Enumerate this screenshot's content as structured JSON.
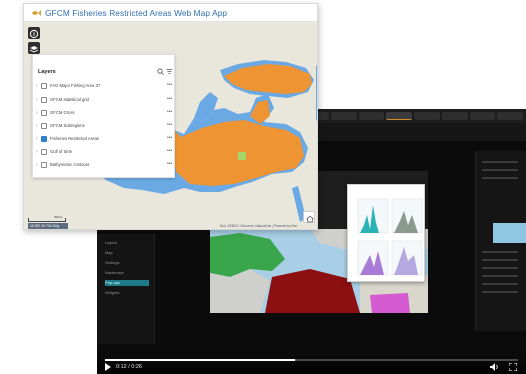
{
  "video": {
    "time": "0:12 / 0:26",
    "progress": 0.46,
    "left_panel_items": [
      "Layers",
      "Map",
      "Settings",
      "Basemaps",
      "Pop-ups",
      "Widgets"
    ],
    "selected_left_item": 4
  },
  "webmap": {
    "title": "GFCM Fisheries Restricted Areas Web Map App",
    "legend": {
      "title": "Layers",
      "layers": [
        {
          "label": "FAO Major Fishing Area 37",
          "checked": false
        },
        {
          "label": "GFCM statistical grid",
          "checked": false
        },
        {
          "label": "GFCM GSAs",
          "checked": false
        },
        {
          "label": "GFCM Subregions",
          "checked": false
        },
        {
          "label": "Fisheries Restricted Areas",
          "checked": true
        },
        {
          "label": "Gulf of Sirte",
          "checked": false
        },
        {
          "label": "Bathymetric contours",
          "checked": false
        }
      ]
    },
    "scale_label": "300mi",
    "coordinates": "15.987 40.734 Deg",
    "attribution": "Esri, GEBCO, DeLorme, NaturalVue | Powered by Esri",
    "colors": {
      "sea": "#6aa9e4",
      "land": "#e9e6dc",
      "fra": "#ef9433",
      "fra_small": "#a9d36b",
      "title": "#2f6fb0"
    }
  }
}
